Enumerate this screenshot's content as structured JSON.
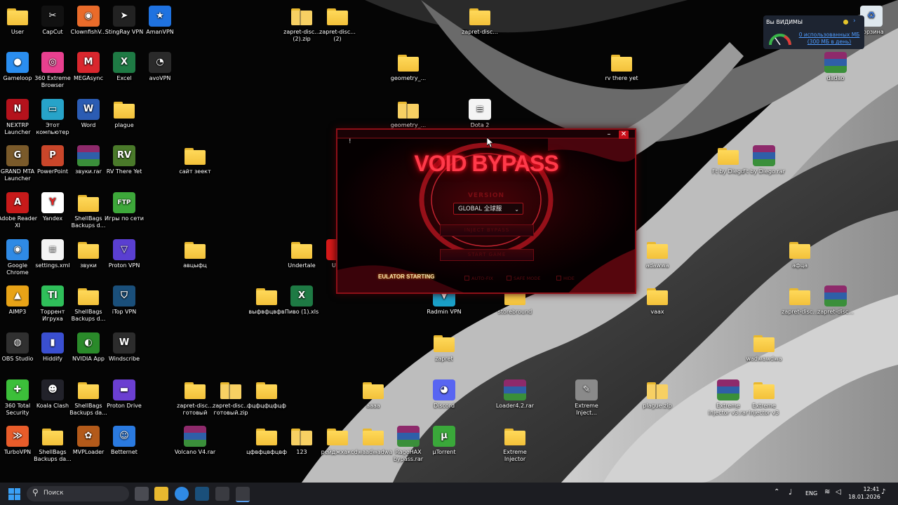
{
  "desktop": {
    "icons": [
      {
        "label": "User",
        "type": "folder"
      },
      {
        "label": "CapCut",
        "type": "app",
        "color": "#111111",
        "glyph": "✂"
      },
      {
        "label": "ClownfishV...",
        "type": "app",
        "color": "#e96b2a",
        "glyph": "◉"
      },
      {
        "label": "StingRay VPN",
        "type": "app",
        "color": "#222222",
        "glyph": "➤"
      },
      {
        "label": "AmanVPN",
        "type": "app",
        "color": "#1f72e0",
        "glyph": "★"
      },
      {
        "label": "Gameloop",
        "type": "app",
        "color": "#2a8ef0",
        "glyph": "●"
      },
      {
        "label": "360 Extreme Browser",
        "type": "app",
        "color": "#e8408f",
        "glyph": "◎"
      },
      {
        "label": "MEGAsync",
        "type": "app",
        "color": "#d9272e",
        "glyph": "M"
      },
      {
        "label": "Excel",
        "type": "app",
        "color": "#1e7a44",
        "glyph": "X"
      },
      {
        "label": "avoVPN",
        "type": "app",
        "color": "#2a2a2a",
        "glyph": "◔"
      },
      {
        "label": "NEXTRP Launcher",
        "type": "app",
        "color": "#b4121c",
        "glyph": "N"
      },
      {
        "label": "Этот компьютер",
        "type": "app",
        "color": "#27a3c9",
        "glyph": "▭"
      },
      {
        "label": "Word",
        "type": "app",
        "color": "#2b5cb3",
        "glyph": "W"
      },
      {
        "label": "plague",
        "type": "folder"
      },
      {
        "label": "GRAND MTA Launcher",
        "type": "app",
        "color": "#7a5a2a",
        "glyph": "G"
      },
      {
        "label": "PowerPoint",
        "type": "app",
        "color": "#c9462a",
        "glyph": "P"
      },
      {
        "label": "звуки.rar",
        "type": "rar"
      },
      {
        "label": "RV There Yet",
        "type": "app",
        "color": "#4a7a2a",
        "glyph": "RV"
      },
      {
        "label": "Adobe Reader XI",
        "type": "app",
        "color": "#c71a1a",
        "glyph": "A"
      },
      {
        "label": "Yandex",
        "type": "app",
        "color": "#ffffff",
        "glyph": "Y",
        "round": true,
        "fg": "#e22"
      },
      {
        "label": "ShellBags Backups d...",
        "type": "folder"
      },
      {
        "label": "Игры по сети",
        "type": "app",
        "color": "#3da83a",
        "glyph": "FTP",
        "round": true
      },
      {
        "label": "Google Chrome",
        "type": "app",
        "color": "#2f8ae5",
        "glyph": "◉",
        "round": true
      },
      {
        "label": "settings.xml",
        "type": "doc"
      },
      {
        "label": "звуки",
        "type": "folder"
      },
      {
        "label": "Proton VPN",
        "type": "app",
        "color": "#5a3fd1",
        "glyph": "▽"
      },
      {
        "label": "AIMP3",
        "type": "app",
        "color": "#e8a317",
        "glyph": "▲",
        "round": true
      },
      {
        "label": "Торрент Игруха",
        "type": "app",
        "color": "#2fbf5a",
        "glyph": "TI"
      },
      {
        "label": "ShellBags Backups d...",
        "type": "folder"
      },
      {
        "label": "iTop VPN",
        "type": "app",
        "color": "#1a4f7a",
        "glyph": "⛉"
      },
      {
        "label": "OBS Studio",
        "type": "app",
        "color": "#303030",
        "glyph": "◍",
        "round": true
      },
      {
        "label": "Hiddify",
        "type": "app",
        "color": "#3a4fd1",
        "glyph": "▮"
      },
      {
        "label": "NVIDIA App",
        "type": "app",
        "color": "#2a8a2a",
        "glyph": "◐"
      },
      {
        "label": "Windscribe",
        "type": "app",
        "color": "#2c2c2c",
        "glyph": "W",
        "round": true
      },
      {
        "label": "360 Total Security",
        "type": "app",
        "color": "#3cbf3a",
        "glyph": "✚",
        "round": true
      },
      {
        "label": "Koala Clash",
        "type": "app",
        "color": "#22222a",
        "glyph": "☻"
      },
      {
        "label": "ShellBags Backups da...",
        "type": "folder"
      },
      {
        "label": "Proton Drive",
        "type": "app",
        "color": "#6b3fd1",
        "glyph": "▬"
      },
      {
        "label": "TurboVPN",
        "type": "app",
        "color": "#e85c2a",
        "glyph": "≫"
      },
      {
        "label": "ShellBags Backups da...",
        "type": "folder"
      },
      {
        "label": "MVPLoader",
        "type": "app",
        "color": "#b35a1a",
        "glyph": "✿",
        "round": true
      },
      {
        "label": "Betternet",
        "type": "app",
        "color": "#2a7ae0",
        "glyph": "☺"
      },
      {
        "label": "zapret-disc... (2).zip",
        "type": "zip"
      },
      {
        "label": "zapret-disc... (2)",
        "type": "folder"
      },
      {
        "label": "zapret-disc...",
        "type": "folder"
      },
      {
        "label": "geometry_...",
        "type": "folder"
      },
      {
        "label": "rv there yet",
        "type": "folder"
      },
      {
        "label": "geometry_...",
        "type": "zip"
      },
      {
        "label": "Dota 2",
        "type": "doc"
      },
      {
        "label": "сайт зеект",
        "type": "folder"
      },
      {
        "label": "Ft by Diego",
        "type": "folder"
      },
      {
        "label": "Ft by Diego.rar",
        "type": "rar"
      },
      {
        "label": "авцыфц",
        "type": "folder"
      },
      {
        "label": "Undertale",
        "type": "folder"
      },
      {
        "label": "Und",
        "type": "app",
        "color": "#d61a1a",
        "glyph": ""
      },
      {
        "label": "adawwa",
        "type": "folder"
      },
      {
        "label": "афца",
        "type": "folder"
      },
      {
        "label": "выфвфцвфв",
        "type": "folder"
      },
      {
        "label": "Пиво (1).xls",
        "type": "app",
        "color": "#1e7a44",
        "glyph": "X"
      },
      {
        "label": "Radmin VPN",
        "type": "app",
        "color": "#1aa0c8",
        "glyph": "▼"
      },
      {
        "label": "storebround",
        "type": "folder"
      },
      {
        "label": "vaax",
        "type": "folder"
      },
      {
        "label": "zapret-disc...",
        "type": "folder"
      },
      {
        "label": "zapret-disc...",
        "type": "rar"
      },
      {
        "label": "zapret",
        "type": "folder"
      },
      {
        "label": "wadwawdwa",
        "type": "folder"
      },
      {
        "label": "zapret-disc... готовый",
        "type": "folder"
      },
      {
        "label": "zapret-disc... готовый.zip",
        "type": "zip"
      },
      {
        "label": "фцфцфцфцф",
        "type": "folder"
      },
      {
        "label": "аааа",
        "type": "folder"
      },
      {
        "label": "Discord",
        "type": "app",
        "color": "#5865f2",
        "glyph": "◕",
        "round": true
      },
      {
        "label": "Loader4.2.rar",
        "type": "rar"
      },
      {
        "label": "Extreme Inject...",
        "type": "app",
        "color": "#8a8a8a",
        "glyph": "✎"
      },
      {
        "label": "plague.zip",
        "type": "zip"
      },
      {
        "label": "Extreme Injector v3.rar",
        "type": "rar"
      },
      {
        "label": "Extreme Injector v3",
        "type": "folder"
      },
      {
        "label": "Volcano V4.rar",
        "type": "rar"
      },
      {
        "label": "цфвфцвфцвф",
        "type": "folder"
      },
      {
        "label": "123",
        "type": "zip"
      },
      {
        "label": "рейджхакс",
        "type": "folder"
      },
      {
        "label": "dwaadwadwa",
        "type": "folder"
      },
      {
        "label": "RageHAX bypass.rar",
        "type": "rar"
      },
      {
        "label": "µTorrent",
        "type": "app",
        "color": "#3aa83a",
        "glyph": "µ",
        "round": true
      },
      {
        "label": "Extreme Injector",
        "type": "folder"
      },
      {
        "label": "dadao",
        "type": "rar"
      },
      {
        "label": "Корзина",
        "type": "app",
        "color": "#dfe8ee",
        "glyph": "♻",
        "fg": "#3a7ae0"
      }
    ]
  },
  "widget": {
    "title": "Вы ВИДИМЫ",
    "usage": "0 использованных МБ",
    "limit": "(300 МБ в день)"
  },
  "void_window": {
    "bang": "!",
    "title": "VOID BYPASS",
    "version_label": "VERSION",
    "version_value": "GLOBAL 全球服",
    "button_1": "INJECT BYPASS",
    "button_2": "START GAME",
    "status": "EULATOR STARTING",
    "option_1": "AUTO-FIX",
    "option_2": "SAFE MODE",
    "option_3": "HIDE",
    "minimize": "–",
    "close": "✕"
  },
  "taskbar": {
    "search_placeholder": "Поиск",
    "lang": "ENG",
    "time": "12:41",
    "date": "18.01.2026"
  },
  "colors": {
    "accent_red": "#ff2a3a",
    "taskbar": "#1c1d22"
  }
}
